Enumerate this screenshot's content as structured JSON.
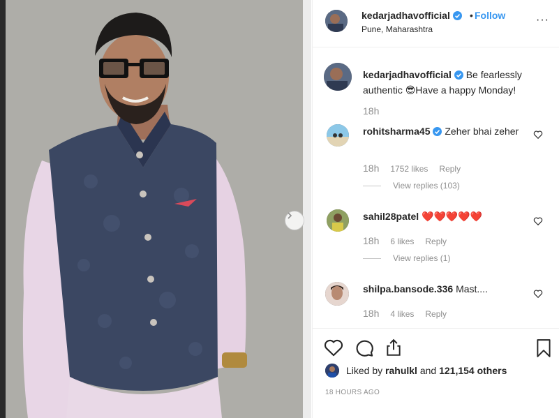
{
  "header": {
    "username": "kedarjadhavofficial",
    "separator": "•",
    "follow_label": "Follow",
    "location": "Pune, Maharashtra",
    "more_label": "···"
  },
  "caption": {
    "username": "kedarjadhavofficial",
    "text": "Be fearlessly authentic 😎Have a happy Monday!",
    "time": "18h"
  },
  "comments": [
    {
      "username": "rohitsharma45",
      "verified": true,
      "text": "Zeher bhai zeher",
      "time": "18h",
      "likes": "1752 likes",
      "reply_label": "Reply",
      "view_replies": "View replies (103)"
    },
    {
      "username": "sahil28patel",
      "verified": false,
      "text": "❤️❤️❤️❤️❤️",
      "time": "18h",
      "likes": "6 likes",
      "reply_label": "Reply",
      "view_replies": "View replies (1)"
    },
    {
      "username": "shilpa.bansode.336",
      "verified": false,
      "text": "Mast....",
      "time": "18h",
      "likes": "4 likes",
      "reply_label": "Reply"
    }
  ],
  "likes": {
    "prefix": "Liked by",
    "user": "rahulkl",
    "middle": "and",
    "others": "121,154 others"
  },
  "posted_ago": "18 HOURS AGO",
  "icons": {
    "like": "heart-icon",
    "comment": "comment-icon",
    "share": "share-icon",
    "save": "bookmark-icon",
    "verified": "verified-badge-icon",
    "next": "chevron-right-icon"
  },
  "colors": {
    "accent": "#3897f0",
    "secondary_text": "#8e8e8e",
    "heart_red": "#ed1c24"
  }
}
